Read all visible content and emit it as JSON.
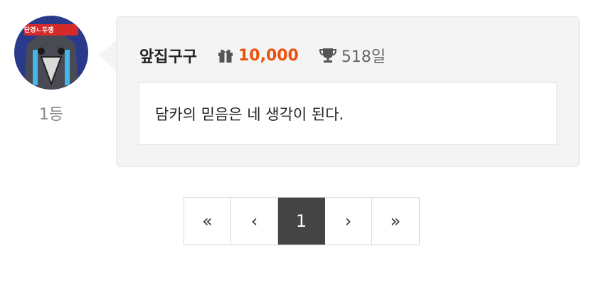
{
  "comment": {
    "rank": "1등",
    "username": "앞집구구",
    "points": "10,000",
    "days": "518일",
    "text": "담카의 믿음은 네 생각이 된다.",
    "avatar_badge_text": "단경ㄴ두쟁"
  },
  "icons": {
    "gift": "gift-icon",
    "trophy": "trophy-icon"
  },
  "pagination": {
    "first": "«",
    "prev": "‹",
    "current": "1",
    "next": "›",
    "last": "»"
  },
  "colors": {
    "points": "#e8520f",
    "active_page": "#444444",
    "card_background": "#f4f4f4"
  }
}
